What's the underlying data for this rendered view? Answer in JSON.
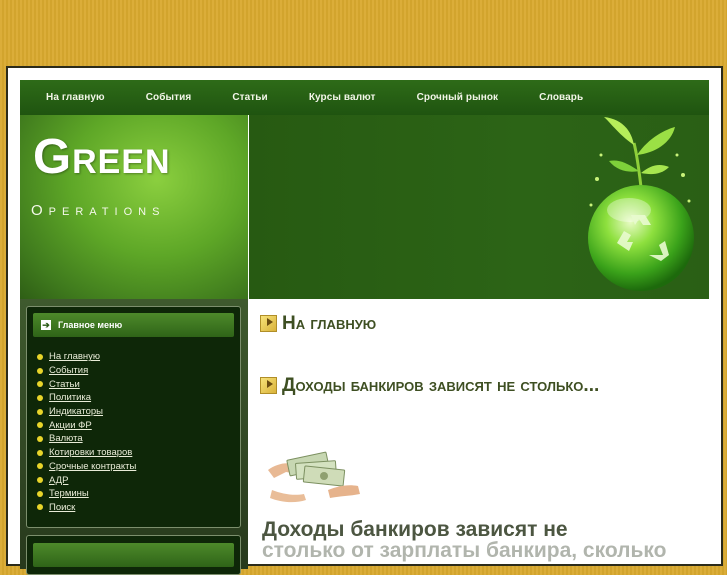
{
  "nav": {
    "items": [
      "На главную",
      "События",
      "Статьи",
      "Курсы валют",
      "Срочный рынок",
      "Словарь"
    ]
  },
  "logo": {
    "main": "Green",
    "sub": "Operations"
  },
  "sidebar": {
    "menu_title": "Главное меню",
    "items": [
      "На главную",
      "События",
      "Статьи",
      "Политика",
      "Индикаторы",
      "Акции ФР",
      "Валюта",
      "Котировки товаров",
      "Срочные контракты",
      "АДР",
      "Термины",
      "Поиск"
    ]
  },
  "content": {
    "heading1": "На главную",
    "heading2": "Доходы банкиров зависят не столько...",
    "article_title": "Доходы банкиров зависят не",
    "article_title_cont": "столько от зарплаты банкира, сколько"
  },
  "colors": {
    "nav_bg": "#2e6b18",
    "page_bg": "#d9a92e",
    "bullet": "#e8d52a",
    "heading": "#3e4f22"
  },
  "icons": [
    "arrow-right-icon",
    "bullet-icon",
    "recycle-globe-icon",
    "money-hands-icon",
    "heading-arrow-icon"
  ]
}
